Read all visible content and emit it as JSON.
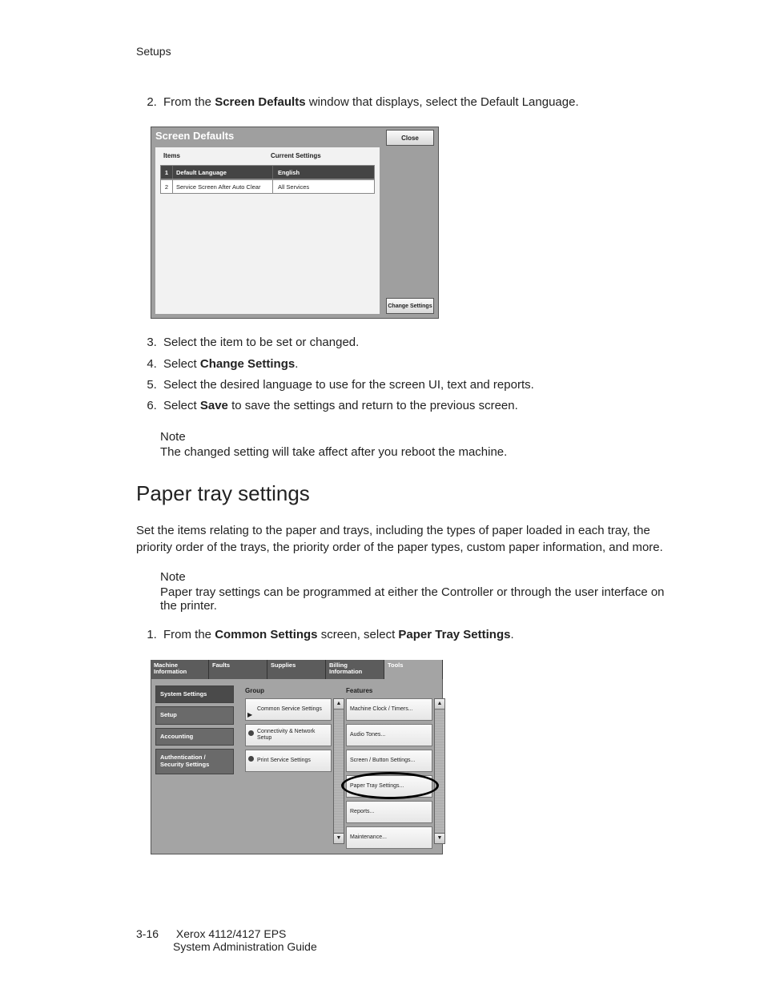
{
  "header": {
    "section": "Setups"
  },
  "step2": {
    "num": "2.",
    "pre": "From the ",
    "bold": "Screen Defaults",
    "post": " window that displays, select the Default Language."
  },
  "screenshot1": {
    "title": "Screen Defaults",
    "close": "Close",
    "hdr_items": "Items",
    "hdr_current": "Current Settings",
    "rows": [
      {
        "num": "1",
        "label": "Default Language",
        "value": "English"
      },
      {
        "num": "2",
        "label": "Service Screen After Auto Clear",
        "value": "All Services"
      }
    ],
    "change": "Change Settings"
  },
  "step3": {
    "num": "3.",
    "text": "Select the item to be set or changed."
  },
  "step4": {
    "num": "4.",
    "pre": "Select ",
    "bold": "Change Settings",
    "post": "."
  },
  "step5": {
    "num": "5.",
    "text": "Select the desired language to use for the screen UI, text and reports."
  },
  "step6": {
    "num": "6.",
    "pre": "Select ",
    "bold": "Save",
    "post": " to save the settings and return to the previous screen."
  },
  "note1": {
    "title": "Note",
    "body": "The changed setting will take affect after you reboot the machine."
  },
  "heading2": "Paper tray settings",
  "para1": "Set the items relating to the paper and trays, including the types of paper loaded in each tray, the priority order of the trays, the priority order of the paper types, custom paper information, and more.",
  "note2": {
    "title": "Note",
    "body": "Paper tray settings can be programmed at either the Controller or through the user interface on the printer."
  },
  "step_b1": {
    "num": "1.",
    "pre": "From the ",
    "bold1": "Common Settings",
    "mid": " screen, select ",
    "bold2": "Paper Tray Settings",
    "post": "."
  },
  "screenshot2": {
    "tabs": [
      "Machine\nInformation",
      "Faults",
      "Supplies",
      "Billing\nInformation",
      "Tools"
    ],
    "sidebar": [
      "System Settings",
      "Setup",
      "Accounting",
      "Authentication / Security Settings"
    ],
    "col_group": "Group",
    "col_features": "Features",
    "group_items": [
      "Common Service Settings",
      "Connectivity & Network Setup",
      "Print Service Settings"
    ],
    "feature_items": [
      "Machine Clock / Timers...",
      "Audio Tones...",
      "Screen / Button Settings...",
      "Paper Tray Settings...",
      "Reports...",
      "Maintenance..."
    ]
  },
  "footer": {
    "page": "3-16",
    "line1": "Xerox 4112/4127 EPS",
    "line2": "System Administration Guide"
  }
}
